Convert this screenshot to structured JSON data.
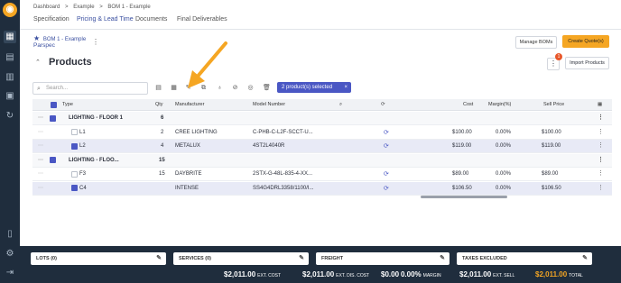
{
  "breadcrumb": [
    "Dashboard",
    ">",
    "Example",
    ">",
    "BOM 1 - Example"
  ],
  "tabs": [
    "Specification",
    "Pricing & Lead Time",
    "Documents",
    "Final Deliverables"
  ],
  "bom": {
    "name": "BOM 1 - Example",
    "sub": "Parspec"
  },
  "buttons": {
    "manage": "Manage BOMs",
    "quote": "Create Quote(s)",
    "import": "Import Products"
  },
  "notification_count": "1",
  "section_title": "Products",
  "search_placeholder": "Search...",
  "selection_badge": "2 product(s) selected",
  "columns": [
    "Type",
    "Qty",
    "Manufacturer",
    "Model Number",
    "Cost",
    "Margin(%)",
    "Sell Price"
  ],
  "rows": [
    {
      "type": "LIGHTING - FLOOR 1",
      "qty": "6",
      "mfr": "",
      "model": "",
      "cost": "",
      "margin": "",
      "sell": "",
      "group": true
    },
    {
      "type": "L1",
      "qty": "2",
      "mfr": "CREE LIGHTING",
      "model": "C-PHB-C-L2F-SCCT-U...",
      "cost": "$100.00",
      "margin": "0.00%",
      "sell": "$100.00"
    },
    {
      "type": "L2",
      "qty": "4",
      "mfr": "METALUX",
      "model": "4ST2L4040R",
      "cost": "$119.00",
      "margin": "0.00%",
      "sell": "$119.00",
      "selected": true
    },
    {
      "type": "LIGHTING - FLOO...",
      "qty": "15",
      "mfr": "",
      "model": "",
      "cost": "",
      "margin": "",
      "sell": "",
      "group": true
    },
    {
      "type": "F3",
      "qty": "15",
      "mfr": "DAYBRITE",
      "model": "2STX-G-48L-835-4-XX...",
      "cost": "$89.00",
      "margin": "0.00%",
      "sell": "$89.00"
    },
    {
      "type": "C4",
      "qty": "",
      "mfr": "INTENSE",
      "model": "SS4G4DRL3358/1100/I...",
      "cost": "$106.50",
      "margin": "0.00%",
      "sell": "$106.50",
      "selected": true
    }
  ],
  "footer": {
    "lots": "LOTS (0)",
    "services": "SERVICES (0)",
    "freight": "FREIGHT",
    "taxes": "TAXES EXCLUDED",
    "ext_cost": "$2,011.00",
    "ext_cost_lbl": "EXT. COST",
    "ext_dis_cost": "$2,011.00",
    "ext_dis_cost_lbl": "EXT. DIS. COST",
    "margin_val": "$0.00",
    "margin_pct": "0.00%",
    "margin_lbl": "MARGIN",
    "ext_sell": "$2,011.00",
    "ext_sell_lbl": "EXT. SELL",
    "total": "$2,011.00",
    "total_lbl": "TOTAL"
  }
}
